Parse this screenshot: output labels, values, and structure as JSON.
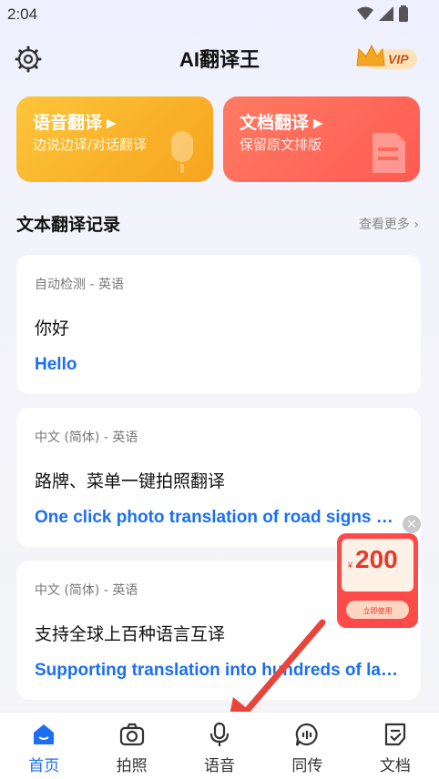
{
  "status": {
    "time": "2:04"
  },
  "header": {
    "title": "AI翻译王",
    "vip_label": "VIP"
  },
  "cards": [
    {
      "title": "语音翻译",
      "subtitle": "边说边译/对话翻译",
      "color": "#fbbf2a"
    },
    {
      "title": "文档翻译",
      "subtitle": "保留原文排版",
      "color": "#ff6e5c"
    }
  ],
  "section": {
    "title": "文本翻译记录",
    "more": "查看更多"
  },
  "records": [
    {
      "lang": "自动检测 - 英语",
      "source": "你好",
      "target": "Hello"
    },
    {
      "lang": "中文 (简体) - 英语",
      "source": "路牌、菜单一键拍照翻译",
      "target": "One click photo translation of road signs and menus"
    },
    {
      "lang": "中文 (简体) - 英语",
      "source": "支持全球上百种语言互译",
      "target": "Supporting translation into hundreds of languages"
    }
  ],
  "promo": {
    "currency": "¥",
    "amount": "200",
    "button": "立即使用"
  },
  "tabs": [
    {
      "label": "首页",
      "icon": "home-icon",
      "active": true
    },
    {
      "label": "拍照",
      "icon": "camera-icon",
      "active": false
    },
    {
      "label": "语音",
      "icon": "microphone-icon",
      "active": false
    },
    {
      "label": "同传",
      "icon": "voice-bubble-icon",
      "active": false
    },
    {
      "label": "文档",
      "icon": "document-icon",
      "active": false
    }
  ],
  "colors": {
    "accent": "#1a6ff3",
    "arrow": "#e8443a"
  }
}
